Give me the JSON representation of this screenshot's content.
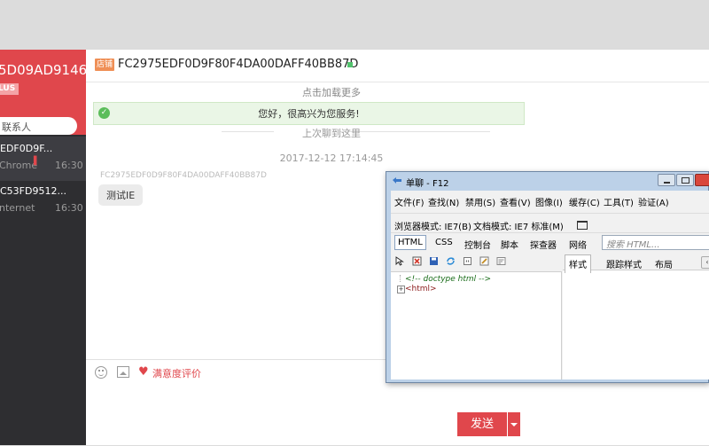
{
  "sidebar": {
    "current_user": {
      "name": "5D09AD9146...",
      "badge": "LUS"
    },
    "search_placeholder": "联系人",
    "sessions": [
      {
        "id": "EDF0D9F...",
        "subtitle": "Chrome",
        "time": "16:30",
        "flag": "▌"
      },
      {
        "id": "C53FD9512...",
        "subtitle": "nternet",
        "time": "16:30"
      }
    ]
  },
  "chat": {
    "shop_tag": "店铺",
    "title": "FC2975EDF0D9F80F4DA00DAFF40BB87D",
    "load_more": "点击加载更多",
    "welcome_icon": "✓",
    "welcome": "您好，很高兴为您服务!",
    "last_read": "上次聊到这里",
    "timestamp": "2017-12-12 17:14:45",
    "message": {
      "sender": "FC2975EDF0D9F80F4DA00DAFF40BB87D",
      "text": "测试IE"
    }
  },
  "toolbar": {
    "heart": "♥",
    "rate_label": "满意度评价"
  },
  "send": {
    "label": "发送"
  },
  "devtools": {
    "title": "单聊 - F12",
    "menu": [
      "文件(F)",
      "查找(N)",
      "禁用(S)",
      "查看(V)",
      "图像(I)",
      "缓存(C)",
      "工具(T)",
      "验证(A)"
    ],
    "browser_mode": "浏览器模式: IE7(B)",
    "doc_mode": "文档模式: IE7 标准(M)",
    "tabs": [
      "HTML",
      "CSS",
      "控制台",
      "脚本",
      "探查器",
      "网络"
    ],
    "search_placeholder": "搜索 HTML...",
    "dom_nodes": [
      "<!-- doctype html -->",
      "<html>"
    ],
    "expand_glyph": "+",
    "right_tabs": [
      "样式",
      "跟踪样式",
      "布局"
    ],
    "right_more": "‹"
  }
}
